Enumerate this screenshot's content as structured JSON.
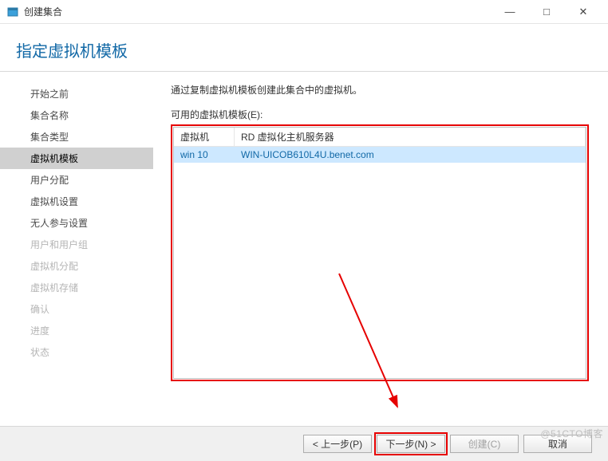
{
  "window": {
    "title": "创建集合",
    "minimize": "—",
    "maximize": "□",
    "close": "✕"
  },
  "header": {
    "title": "指定虚拟机模板"
  },
  "sidebar": {
    "items": [
      {
        "label": "开始之前",
        "state": "normal"
      },
      {
        "label": "集合名称",
        "state": "normal"
      },
      {
        "label": "集合类型",
        "state": "normal"
      },
      {
        "label": "虚拟机模板",
        "state": "active"
      },
      {
        "label": "用户分配",
        "state": "normal"
      },
      {
        "label": "虚拟机设置",
        "state": "normal"
      },
      {
        "label": "无人参与设置",
        "state": "normal"
      },
      {
        "label": "用户和用户组",
        "state": "disabled"
      },
      {
        "label": "虚拟机分配",
        "state": "disabled"
      },
      {
        "label": "虚拟机存储",
        "state": "disabled"
      },
      {
        "label": "确认",
        "state": "disabled"
      },
      {
        "label": "进度",
        "state": "disabled"
      },
      {
        "label": "状态",
        "state": "disabled"
      }
    ]
  },
  "main": {
    "instruction": "通过复制虚拟机模板创建此集合中的虚拟机。",
    "list_label": "可用的虚拟机模板(E):",
    "columns": {
      "vm": "虚拟机",
      "host": "RD 虚拟化主机服务器"
    },
    "rows": [
      {
        "vm": "win  10",
        "host": "WIN-UICOB610L4U.benet.com"
      }
    ]
  },
  "footer": {
    "prev": "< 上一步(P)",
    "next": "下一步(N) >",
    "create": "创建(C)",
    "cancel": "取消"
  },
  "watermark": "@51CTO博客"
}
